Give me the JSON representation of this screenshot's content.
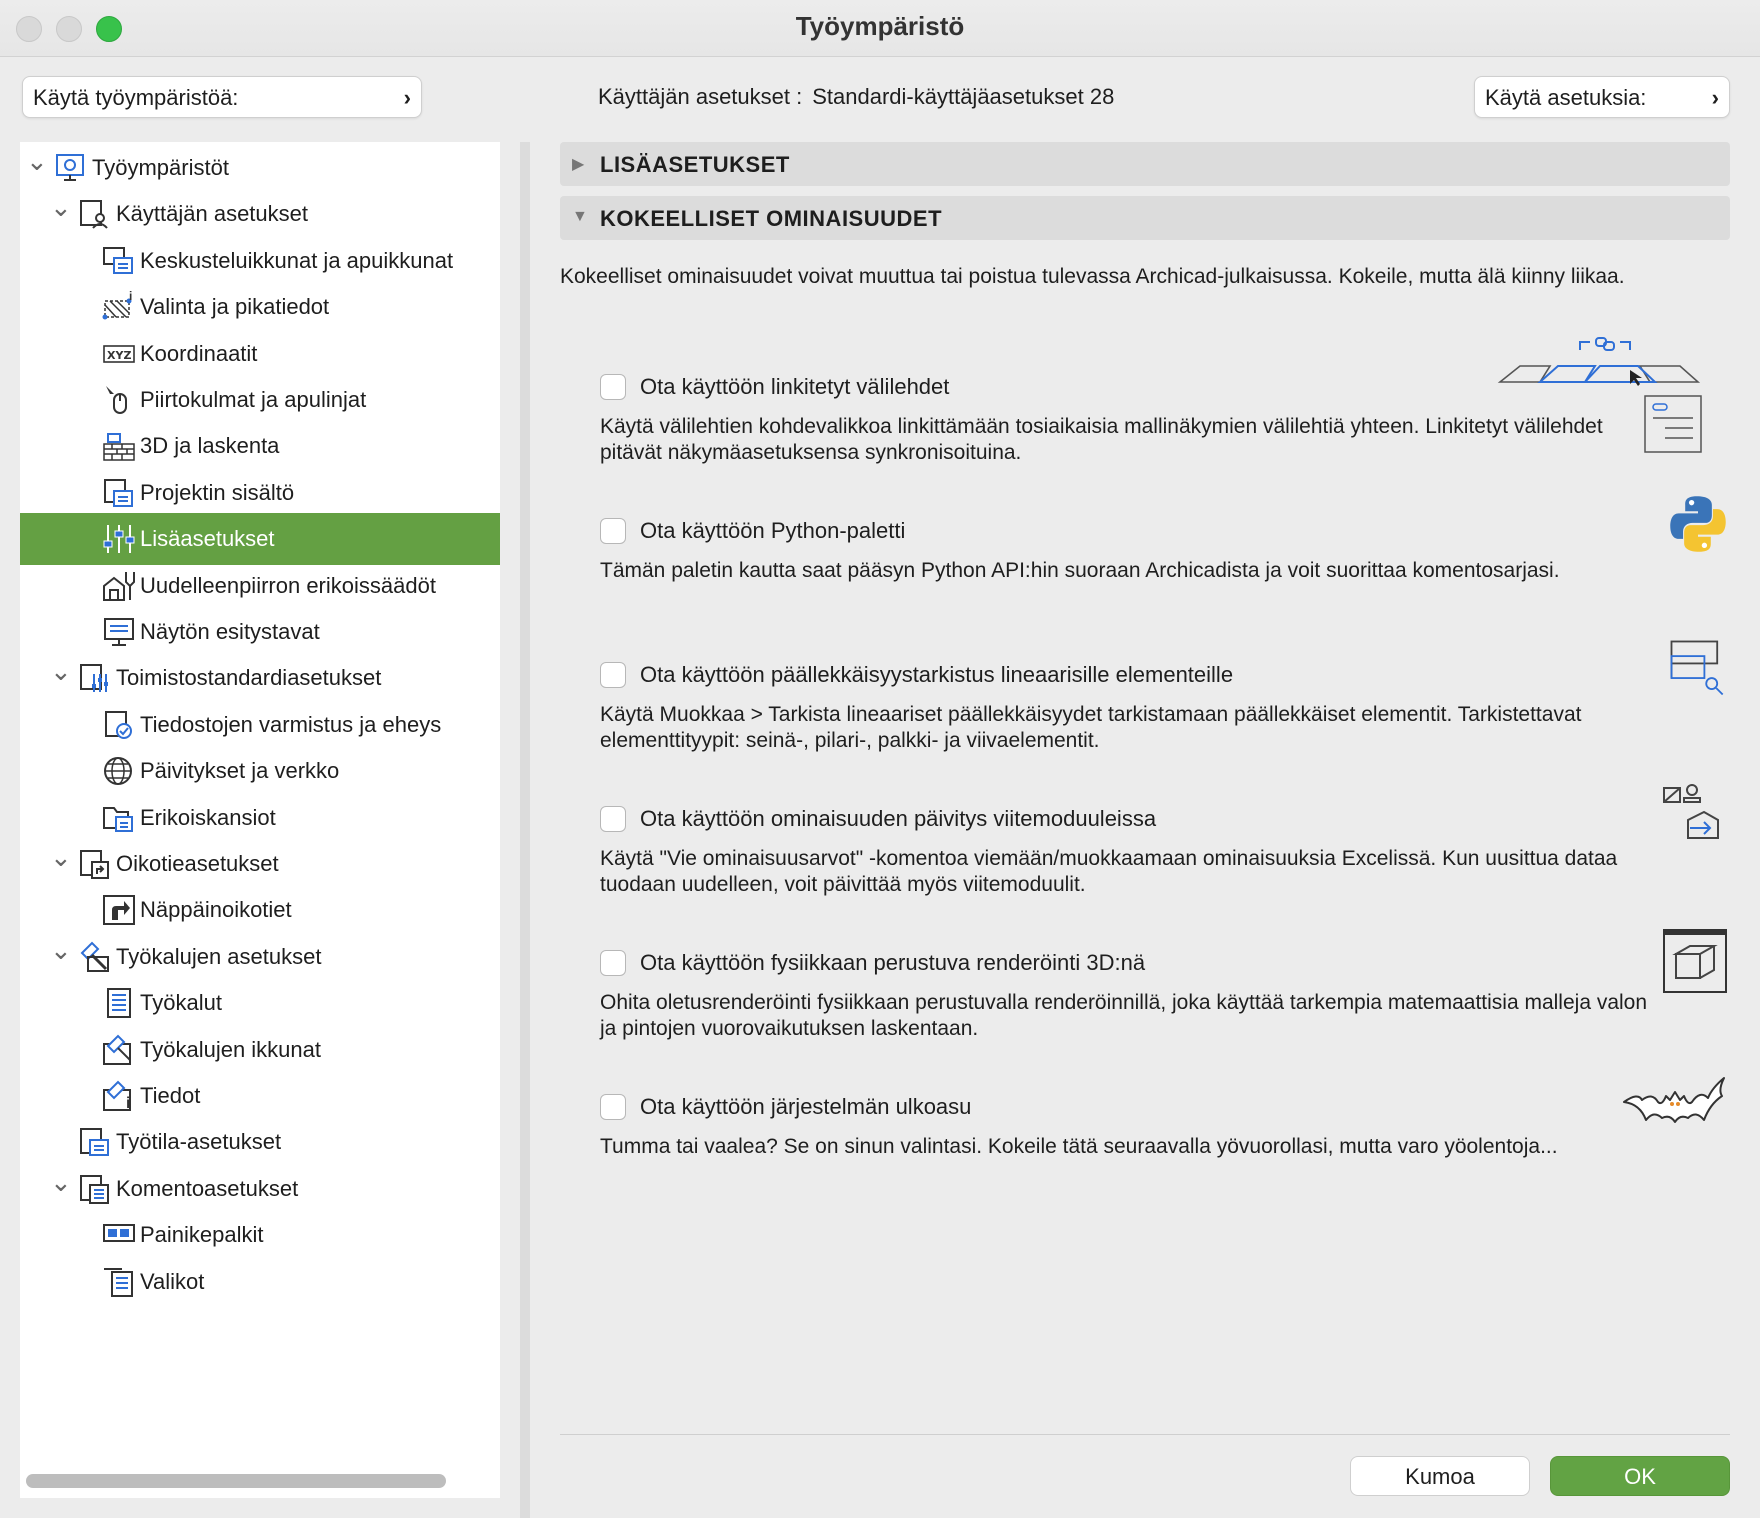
{
  "window": {
    "title": "Työympäristö"
  },
  "topbar": {
    "apply_workspace": "Käytä työympäristöä:",
    "user_settings_label": "Käyttäjän asetukset :",
    "user_settings_value": "Standardi-käyttäjäasetukset 28",
    "apply_settings": "Käytä asetuksia:"
  },
  "tree": [
    {
      "label": "Työympäristöt",
      "level": 0,
      "expanded": true,
      "icon": "workspaces-icon"
    },
    {
      "label": "Käyttäjän asetukset",
      "level": 1,
      "expanded": true,
      "icon": "user-settings-icon"
    },
    {
      "label": "Keskusteluikkunat ja apuikkunat",
      "level": 2,
      "icon": "dialogs-icon"
    },
    {
      "label": "Valinta ja pikatiedot",
      "level": 2,
      "icon": "selection-icon"
    },
    {
      "label": "Koordinaatit",
      "level": 2,
      "icon": "xyz-icon"
    },
    {
      "label": "Piirtokulmat ja apulinjat",
      "level": 2,
      "icon": "mouse-icon"
    },
    {
      "label": "3D ja laskenta",
      "level": 2,
      "icon": "bricks-icon"
    },
    {
      "label": "Projektin sisältö",
      "level": 2,
      "icon": "project-icon"
    },
    {
      "label": "Lisäasetukset",
      "level": 2,
      "icon": "sliders-icon",
      "selected": true
    },
    {
      "label": "Uudelleenpiirron erikoissäädöt",
      "level": 2,
      "icon": "redraw-icon"
    },
    {
      "label": "Näytön esitystavat",
      "level": 2,
      "icon": "display-icon"
    },
    {
      "label": "Toimistostandardiasetukset",
      "level": 1,
      "expanded": true,
      "icon": "office-standards-icon"
    },
    {
      "label": "Tiedostojen varmistus ja eheys",
      "level": 2,
      "icon": "file-safety-icon"
    },
    {
      "label": "Päivitykset ja verkko",
      "level": 2,
      "icon": "globe-icon"
    },
    {
      "label": "Erikoiskansiot",
      "level": 2,
      "icon": "folder-icon"
    },
    {
      "label": "Oikotieasetukset",
      "level": 1,
      "expanded": true,
      "icon": "shortcut-settings-icon"
    },
    {
      "label": "Näppäinoikotiet",
      "level": 2,
      "icon": "shortcut-arrow-icon"
    },
    {
      "label": "Työkalujen asetukset",
      "level": 1,
      "expanded": true,
      "icon": "tools-settings-icon"
    },
    {
      "label": "Työkalut",
      "level": 2,
      "icon": "tools-list-icon"
    },
    {
      "label": "Työkalujen ikkunat",
      "level": 2,
      "icon": "tool-windows-icon"
    },
    {
      "label": "Tiedot",
      "level": 2,
      "icon": "info-icon"
    },
    {
      "label": "Työtila-asetukset",
      "level": 1,
      "expanded": false,
      "icon": "worktime-icon"
    },
    {
      "label": "Komentoasetukset",
      "level": 1,
      "expanded": true,
      "icon": "command-settings-icon"
    },
    {
      "label": "Painikepalkit",
      "level": 2,
      "icon": "toolbar-icon"
    },
    {
      "label": "Valikot",
      "level": 2,
      "icon": "menus-icon"
    }
  ],
  "sections": {
    "more_settings": "LISÄASETUKSET",
    "experimental": "KOKEELLISET OMINAISUUDET"
  },
  "intro": "Kokeelliset ominaisuudet voivat muuttua tai poistua tulevassa Archicad-julkaisussa. Kokeile, mutta älä kiinny liikaa.",
  "features": [
    {
      "title": "Ota käyttöön linkitetyt välilehdet",
      "desc": "Käytä välilehtien kohdevalikkoa linkittämään tosiaikaisia mallinäkymien välilehtiä yhteen. Linkitetyt välilehdet pitävät näkymäasetuksensa synkronisoituina.",
      "checked": false,
      "icon": "linked-tabs-icon"
    },
    {
      "title": "Ota käyttöön Python-paletti",
      "desc": "Tämän paletin kautta saat pääsyn Python API:hin suoraan Archicadista ja voit suorittaa komentosarjasi.",
      "checked": false,
      "icon": "python-icon"
    },
    {
      "title": "Ota käyttöön päällekkäisyystarkistus lineaarisille elementeille",
      "desc": "Käytä Muokkaa > Tarkista lineaariset päällekkäisyydet tarkistamaan päällekkäiset elementit. Tarkistettavat elementtityypit: seinä-, pilari-, palkki- ja viivaelementit.",
      "checked": false,
      "icon": "overlap-check-icon"
    },
    {
      "title": "Ota käyttöön ominaisuuden päivitys viitemoduuleissa",
      "desc": "Käytä \"Vie ominaisuusarvot\" -komentoa viemään/muokkaamaan ominaisuuksia Excelissä. Kun uusittua dataa tuodaan uudelleen, voit päivittää myös viitemoduulit.",
      "checked": false,
      "icon": "property-update-icon"
    },
    {
      "title": "Ota käyttöön fysiikkaan perustuva renderöinti 3D:nä",
      "desc": "Ohita oletusrenderöinti fysiikkaan perustuvalla renderöinnillä, joka käyttää tarkempia matemaattisia malleja valon ja pintojen vuorovaikutuksen laskentaan.",
      "checked": false,
      "icon": "3d-cube-icon"
    },
    {
      "title": "Ota käyttöön järjestelmän ulkoasu",
      "desc": "Tumma tai vaalea? Se on sinun valintasi. Kokeile tätä seuraavalla yövuorollasi, mutta varo yöolentoja...",
      "checked": false,
      "icon": "bat-icon"
    }
  ],
  "buttons": {
    "cancel": "Kumoa",
    "ok": "OK"
  },
  "colors": {
    "selection": "#64a043",
    "ok": "#62a344",
    "icon_blue": "#2f6fd6"
  }
}
